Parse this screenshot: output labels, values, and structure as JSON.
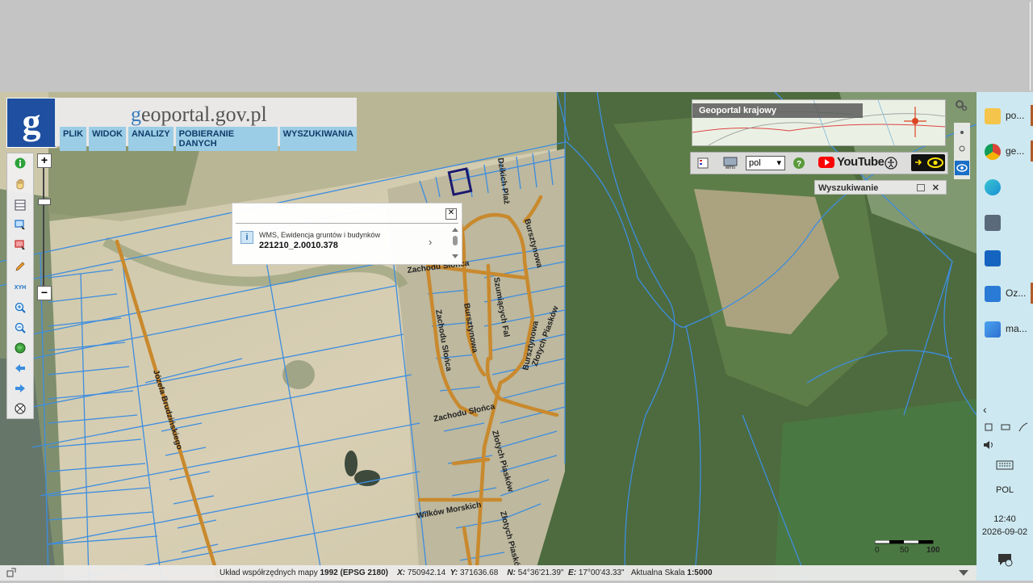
{
  "header": {
    "site_title_prefix": "g",
    "site_title_rest": "eoportal.gov.pl",
    "menu": [
      "PLIK",
      "WIDOK",
      "ANALIZY",
      "POBIERANIE DANYCH",
      "WYSZUKIWANIA"
    ]
  },
  "toolbar": {
    "tools": [
      "info-icon",
      "pan-hand-icon",
      "table-icon",
      "select-rectangle-icon",
      "select-delete-icon",
      "pencil-icon",
      "xyh-icon",
      "zoom-in-icon",
      "zoom-out-icon",
      "globe-icon",
      "back-arrow-icon",
      "forward-arrow-icon",
      "measure-icon"
    ],
    "xyh_label": "XYH",
    "zoom_in": "+",
    "zoom_out": "−"
  },
  "popup": {
    "source": "WMS, Ewidencja gruntów i budynków",
    "parcel_id": "221210_2.0010.378",
    "close": "✕",
    "next": "›"
  },
  "minimap": {
    "label": "Geoportal krajowy"
  },
  "iconbar": {
    "language": "pol",
    "youtube": "YouTube"
  },
  "search_panel": {
    "title": "Wyszukiwanie"
  },
  "streets": {
    "jozefa": "Józefa Brudzińskiego",
    "zachodu1": "Zachodu Słońca",
    "zachodu2": "Zachodu Słońca",
    "zachodu3": "Zachodu Słońca",
    "bursztynowa1": "Bursztynowa",
    "bursztynowa2": "Bursztynowa",
    "bursztynowa3": "Bursztynowa",
    "szumiacych": "Szumiących Fal",
    "zlotych1": "Złotych Piasków",
    "zlotych2": "Złotych Piasków",
    "zlotych3": "Złotych Piasków",
    "wilkow": "Wilków Morskich",
    "dzikich": "Dzikich Plaż"
  },
  "scale": {
    "zero": "0",
    "mid": "50",
    "end": "100m"
  },
  "status": {
    "coord_system_label": "Układ współrzędnych mapy",
    "coord_system_value": "1992 (EPSG 2180)",
    "x_label": "X:",
    "x_value": "750942.14",
    "y_label": "Y:",
    "y_value": "371636.68",
    "n_label": "N:",
    "n_value": "54°36'21.39\"",
    "e_label": "E:",
    "e_value": "17°00'43.33\"",
    "scale_label": "Aktualna Skala",
    "scale_value": "1:5000"
  },
  "taskbar": {
    "apps": [
      {
        "label": "po...",
        "icon": "folder-icon",
        "color": "#f4c54a"
      },
      {
        "label": "ge...",
        "icon": "chrome-icon",
        "color": "#db4437"
      },
      {
        "label": "",
        "icon": "edge-icon",
        "color": "#1c8fd6"
      },
      {
        "label": "",
        "icon": "calculator-icon",
        "color": "#5a6a7a"
      },
      {
        "label": "",
        "icon": "store-icon",
        "color": "#1565c0"
      },
      {
        "label": "Oz...",
        "icon": "document-icon",
        "color": "#2a7bd5"
      },
      {
        "label": "ma...",
        "icon": "photos-icon",
        "color": "#2f6fd0"
      }
    ],
    "lang": "POL",
    "time": "12:40",
    "date": "2026-09-02"
  }
}
